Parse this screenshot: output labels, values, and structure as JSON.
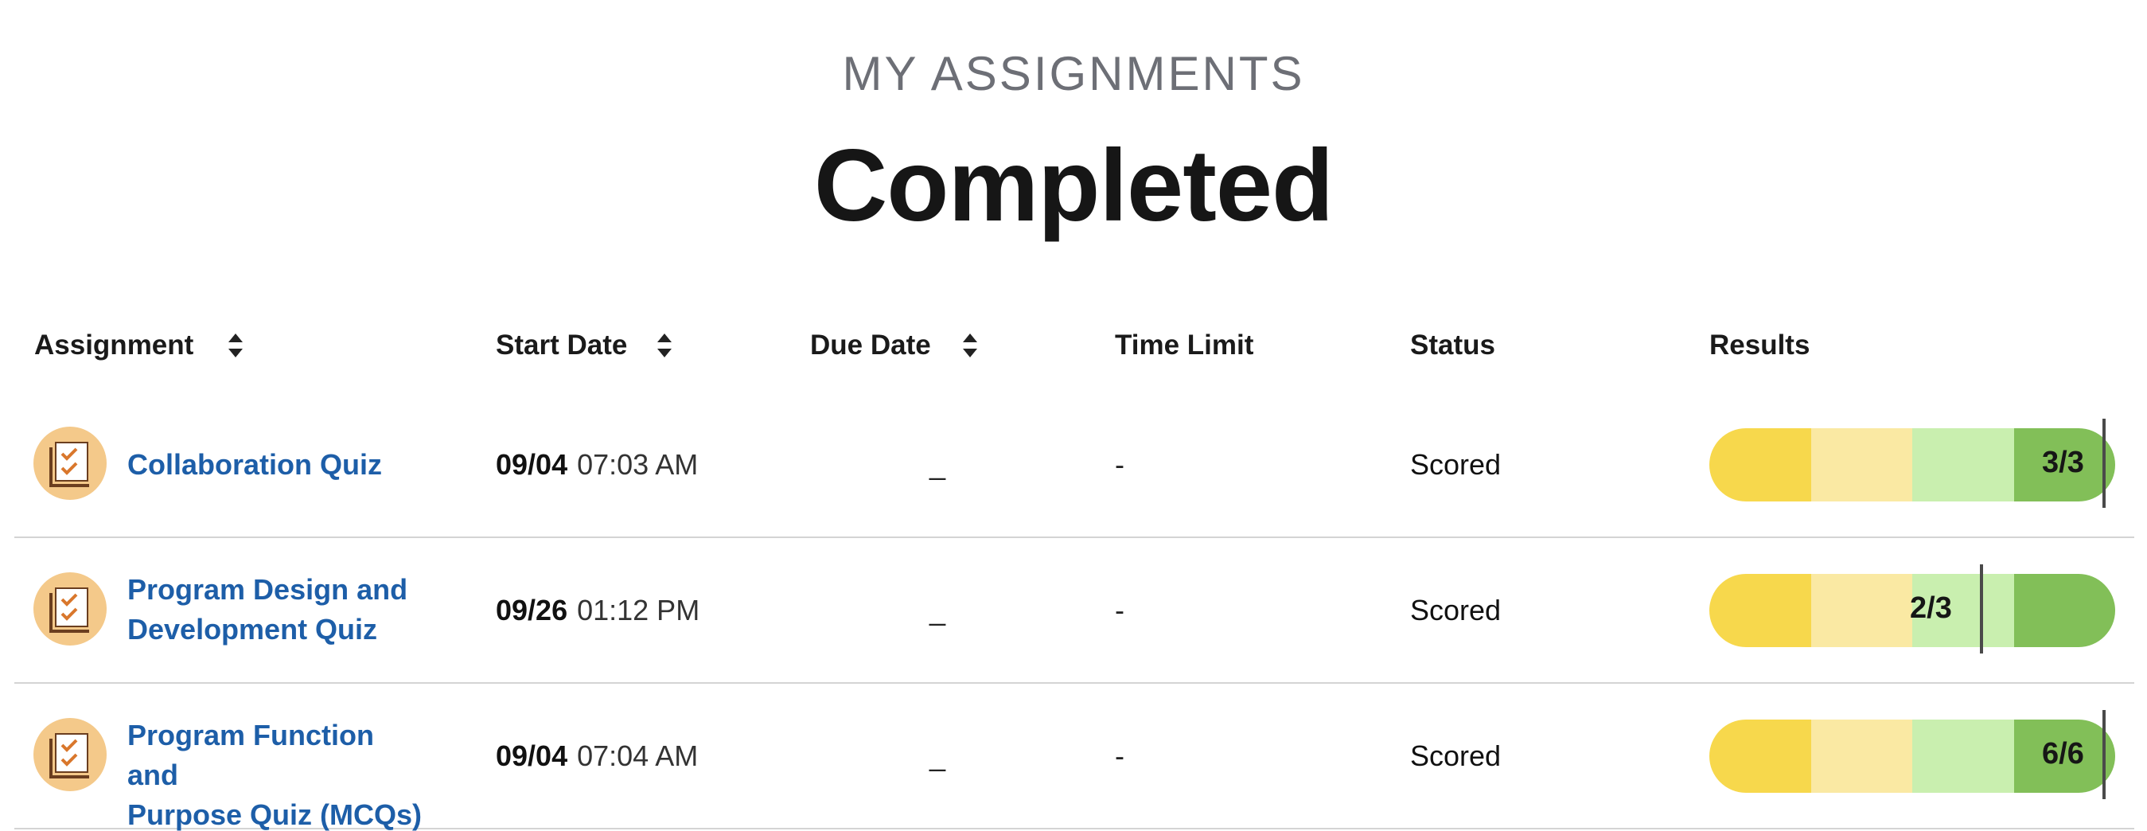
{
  "header": {
    "eyebrow": "MY ASSIGNMENTS",
    "title": "Completed"
  },
  "columns": {
    "assignment": "Assignment",
    "start_date": "Start Date",
    "due_date": "Due Date",
    "time_limit": "Time Limit",
    "status": "Status",
    "results": "Results"
  },
  "icons": {
    "sort": "sort-updown-icon",
    "assignment": "quiz-checklist-icon"
  },
  "colors": {
    "link": "#1d5ea8",
    "icon_bg": "#f4c98a",
    "result_band_1": "#f7d84c",
    "result_band_2": "#fae9a3",
    "result_band_3": "#c9efaf",
    "result_band_4": "#82bf58"
  },
  "rows": [
    {
      "title_line1": "Collaboration Quiz",
      "title_line2": "",
      "start_md": "09/04",
      "start_time": "07:03 AM",
      "due": "_",
      "time_limit": "-",
      "status": "Scored",
      "score_text": "3/3",
      "score_fraction": 1.0
    },
    {
      "title_line1": "Program Design and",
      "title_line2": "Development Quiz",
      "start_md": "09/26",
      "start_time": "01:12 PM",
      "due": "_",
      "time_limit": "-",
      "status": "Scored",
      "score_text": "2/3",
      "score_fraction": 0.667
    },
    {
      "title_line1": "Program Function and",
      "title_line2": "Purpose Quiz (MCQs)",
      "start_md": "09/04",
      "start_time": "07:04 AM",
      "due": "_",
      "time_limit": "-",
      "status": "Scored",
      "score_text": "6/6",
      "score_fraction": 1.0
    }
  ]
}
